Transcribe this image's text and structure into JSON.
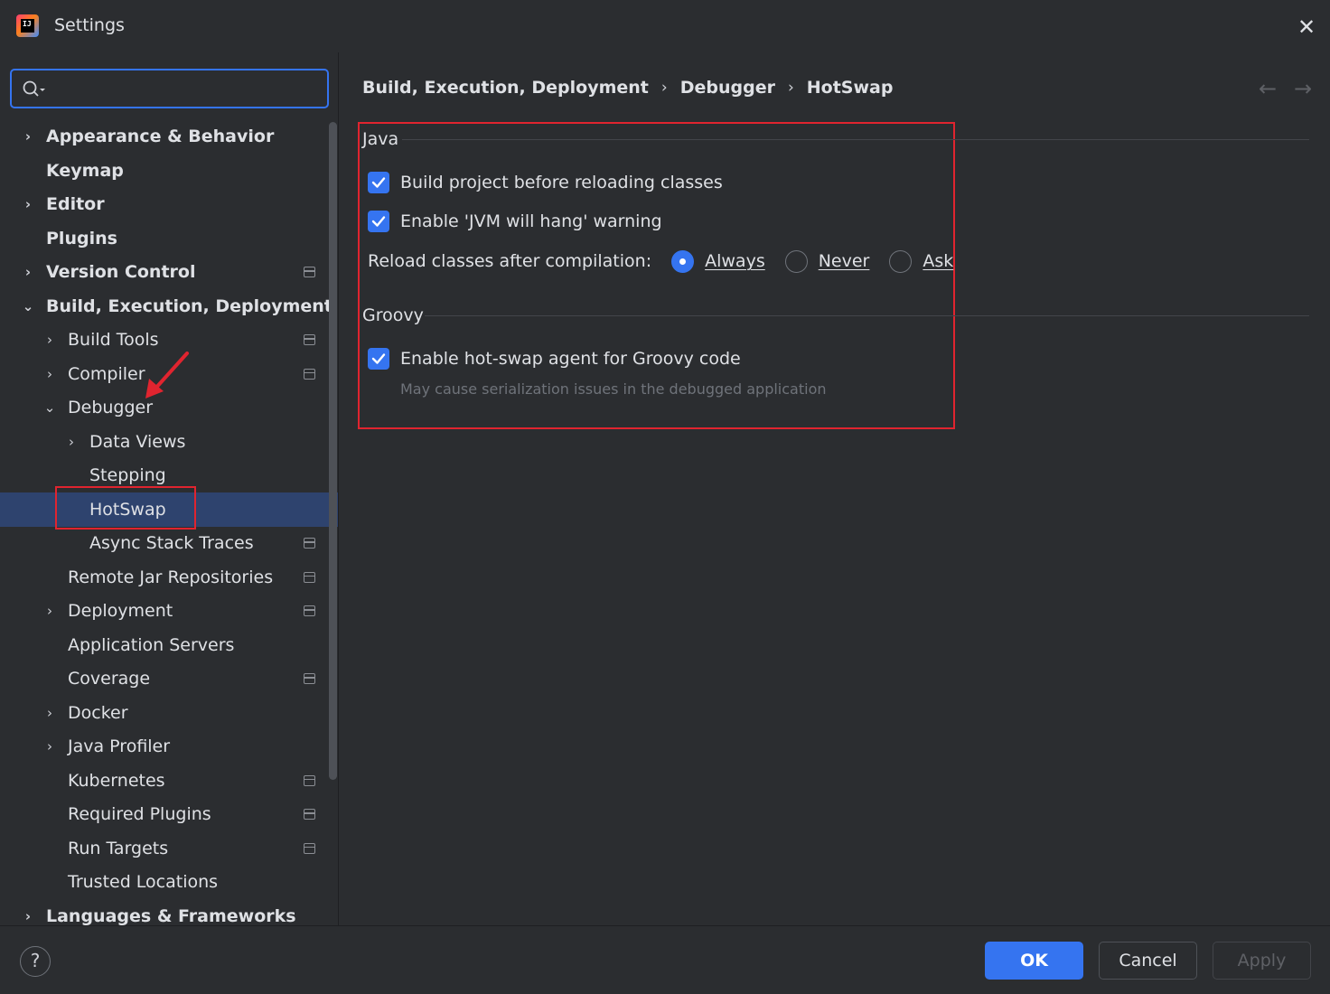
{
  "window": {
    "title": "Settings",
    "logo_text": "IJ",
    "close_icon": "close-icon"
  },
  "search": {
    "value": "",
    "placeholder": ""
  },
  "sidebar": {
    "items": [
      {
        "label": "Appearance & Behavior",
        "chevron": "›",
        "bold": true,
        "level": 0,
        "has_project_icon": false,
        "selected": false
      },
      {
        "label": "Keymap",
        "chevron": "",
        "bold": true,
        "level": 0,
        "has_project_icon": false,
        "selected": false
      },
      {
        "label": "Editor",
        "chevron": "›",
        "bold": true,
        "level": 0,
        "has_project_icon": false,
        "selected": false
      },
      {
        "label": "Plugins",
        "chevron": "",
        "bold": true,
        "level": 0,
        "has_project_icon": false,
        "selected": false
      },
      {
        "label": "Version Control",
        "chevron": "›",
        "bold": true,
        "level": 0,
        "has_project_icon": true,
        "selected": false
      },
      {
        "label": "Build, Execution, Deployment",
        "chevron": "⌄",
        "bold": true,
        "level": 0,
        "has_project_icon": false,
        "selected": false
      },
      {
        "label": "Build Tools",
        "chevron": "›",
        "bold": false,
        "level": 1,
        "has_project_icon": true,
        "selected": false
      },
      {
        "label": "Compiler",
        "chevron": "›",
        "bold": false,
        "level": 1,
        "has_project_icon": true,
        "selected": false
      },
      {
        "label": "Debugger",
        "chevron": "⌄",
        "bold": false,
        "level": 1,
        "has_project_icon": false,
        "selected": false
      },
      {
        "label": "Data Views",
        "chevron": "›",
        "bold": false,
        "level": 2,
        "has_project_icon": false,
        "selected": false
      },
      {
        "label": "Stepping",
        "chevron": "",
        "bold": false,
        "level": 2,
        "has_project_icon": false,
        "selected": false
      },
      {
        "label": "HotSwap",
        "chevron": "",
        "bold": false,
        "level": 2,
        "has_project_icon": false,
        "selected": true
      },
      {
        "label": "Async Stack Traces",
        "chevron": "",
        "bold": false,
        "level": 2,
        "has_project_icon": true,
        "selected": false
      },
      {
        "label": "Remote Jar Repositories",
        "chevron": "",
        "bold": false,
        "level": 1,
        "has_project_icon": true,
        "selected": false
      },
      {
        "label": "Deployment",
        "chevron": "›",
        "bold": false,
        "level": 1,
        "has_project_icon": true,
        "selected": false
      },
      {
        "label": "Application Servers",
        "chevron": "",
        "bold": false,
        "level": 1,
        "has_project_icon": false,
        "selected": false
      },
      {
        "label": "Coverage",
        "chevron": "",
        "bold": false,
        "level": 1,
        "has_project_icon": true,
        "selected": false
      },
      {
        "label": "Docker",
        "chevron": "›",
        "bold": false,
        "level": 1,
        "has_project_icon": false,
        "selected": false
      },
      {
        "label": "Java Profiler",
        "chevron": "›",
        "bold": false,
        "level": 1,
        "has_project_icon": false,
        "selected": false
      },
      {
        "label": "Kubernetes",
        "chevron": "",
        "bold": false,
        "level": 1,
        "has_project_icon": true,
        "selected": false
      },
      {
        "label": "Required Plugins",
        "chevron": "",
        "bold": false,
        "level": 1,
        "has_project_icon": true,
        "selected": false
      },
      {
        "label": "Run Targets",
        "chevron": "",
        "bold": false,
        "level": 1,
        "has_project_icon": true,
        "selected": false
      },
      {
        "label": "Trusted Locations",
        "chevron": "",
        "bold": false,
        "level": 1,
        "has_project_icon": false,
        "selected": false
      },
      {
        "label": "Languages & Frameworks",
        "chevron": "›",
        "bold": true,
        "level": 0,
        "has_project_icon": false,
        "selected": false
      }
    ]
  },
  "breadcrumb": {
    "items": [
      "Build, Execution, Deployment",
      "Debugger",
      "HotSwap"
    ],
    "separator": "›",
    "back_icon": "←",
    "forward_icon": "→"
  },
  "java_group": {
    "title": "Java",
    "build_before_reload": {
      "label": "Build project before reloading classes",
      "checked": true
    },
    "jvm_hang_warning": {
      "label": "Enable 'JVM will hang' warning",
      "checked": true
    },
    "reload_after_compilation": {
      "label": "Reload classes after compilation:",
      "options": [
        {
          "label": "Always",
          "selected": true
        },
        {
          "label": "Never",
          "selected": false
        },
        {
          "label": "Ask",
          "selected": false
        }
      ]
    }
  },
  "groovy_group": {
    "title": "Groovy",
    "hotswap_agent": {
      "label": "Enable hot-swap agent for Groovy code",
      "checked": true
    },
    "hint": "May cause serialization issues in the debugged application"
  },
  "footer": {
    "help_label": "?",
    "ok_label": "OK",
    "cancel_label": "Cancel",
    "apply_label": "Apply"
  },
  "colors": {
    "background": "#2b2d30",
    "accent": "#3574f0",
    "selection": "#2e436e",
    "annotation_red": "#e0242f"
  }
}
